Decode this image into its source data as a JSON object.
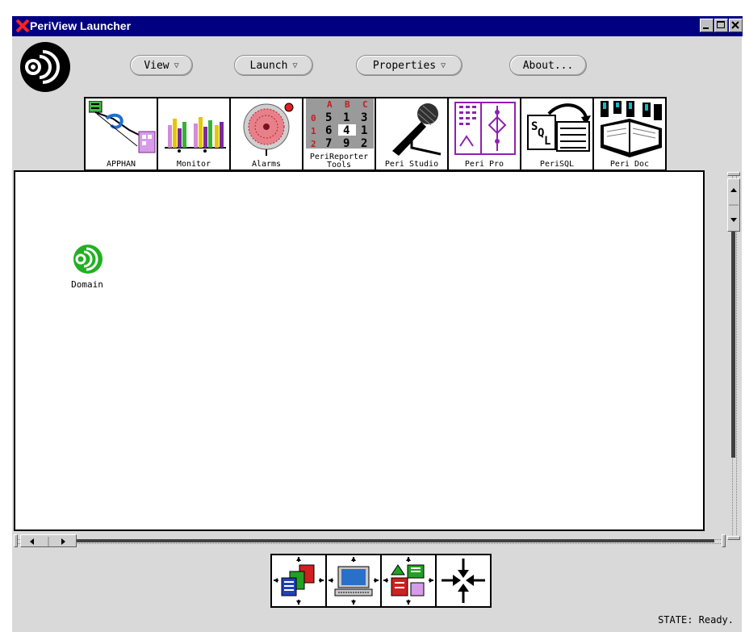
{
  "window": {
    "title": "PeriView Launcher"
  },
  "menu": {
    "view_label": "View",
    "launch_label": "Launch",
    "properties_label": "Properties",
    "about_label": "About...",
    "dropdown_glyph": "▽"
  },
  "tiles": [
    {
      "id": "apphan",
      "label": "APPHAN",
      "icon": "apphan-icon"
    },
    {
      "id": "monitor",
      "label": "Monitor",
      "icon": "bar-chart-icon"
    },
    {
      "id": "alarms",
      "label": "Alarms",
      "icon": "alarm-bell-icon"
    },
    {
      "id": "perireporter",
      "label": "PeriReporter",
      "label2": "Tools",
      "icon": "number-grid-icon"
    },
    {
      "id": "peristudio",
      "label": "Peri Studio",
      "icon": "microphone-icon"
    },
    {
      "id": "peripro",
      "label": "Peri Pro",
      "icon": "flowchart-icon"
    },
    {
      "id": "perisql",
      "label": "PeriSQL",
      "icon": "sql-icon"
    },
    {
      "id": "peridoc",
      "label": "Peri Doc",
      "icon": "book-icon"
    }
  ],
  "reporter_grid": {
    "header": [
      "A",
      "B",
      "C"
    ],
    "rows": [
      [
        "0",
        "5",
        "1",
        "3"
      ],
      [
        "1",
        "6",
        "4",
        "1"
      ],
      [
        "2",
        "7",
        "9",
        "2"
      ]
    ]
  },
  "canvas": {
    "items": [
      {
        "label": "Domain",
        "icon": "domain-icon"
      }
    ]
  },
  "view_tools": [
    {
      "id": "expand-panels",
      "icon": "expand-panels-icon"
    },
    {
      "id": "expand-computer",
      "icon": "expand-computer-icon"
    },
    {
      "id": "expand-shapes",
      "icon": "expand-shapes-icon"
    },
    {
      "id": "collapse",
      "icon": "collapse-arrows-icon"
    }
  ],
  "status": {
    "text": "STATE: Ready."
  },
  "colors": {
    "titlebar": "#000080",
    "domain_icon": "#22b022",
    "background": "#d9d9d9"
  }
}
